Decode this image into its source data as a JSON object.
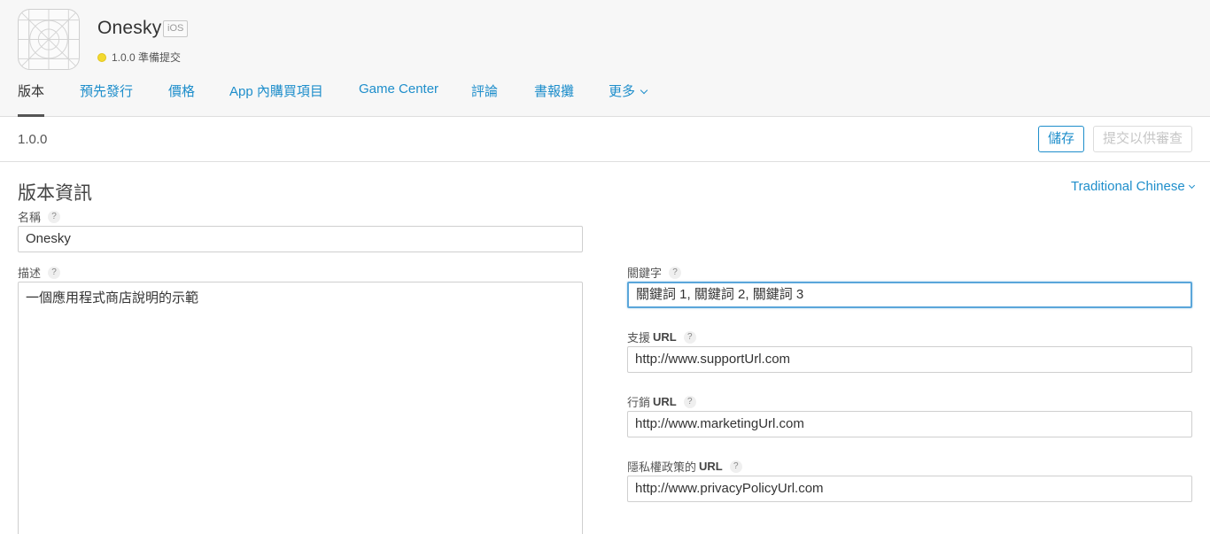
{
  "app": {
    "name": "Onesky",
    "platform": "iOS",
    "status_text": "1.0.0 準備提交",
    "status_color": "#f3d92f"
  },
  "tabs": [
    {
      "label": "版本",
      "active": true
    },
    {
      "label": "預先發行"
    },
    {
      "label": "價格"
    },
    {
      "label": "App 內購買項目"
    },
    {
      "label": "Game Center"
    },
    {
      "label": "評論"
    },
    {
      "label": "書報攤"
    },
    {
      "label": "更多"
    }
  ],
  "version_bar": {
    "version": "1.0.0",
    "save_label": "儲存",
    "submit_label": "提交以供審查"
  },
  "form": {
    "section_title": "版本資訊",
    "language": "Traditional Chinese",
    "name_label": "名稱",
    "name_value": "Onesky",
    "description_label": "描述",
    "description_value": "一個應用程式商店說明的示範",
    "keywords_label": "關鍵字",
    "keywords_value": "關鍵詞 1, 關鍵詞 2, 關鍵詞 3",
    "support_label_prefix": "支援",
    "support_label_suffix": "URL",
    "support_value": "http://www.supportUrl.com",
    "marketing_label_prefix": "行銷",
    "marketing_label_suffix": "URL",
    "marketing_value": "http://www.marketingUrl.com",
    "privacy_label_prefix": "隱私權政策的",
    "privacy_label_suffix": "URL",
    "privacy_value": "http://www.privacyPolicyUrl.com",
    "help_glyph": "?"
  },
  "colors": {
    "accent": "#1e8ecb",
    "focus": "#5aa6da"
  }
}
